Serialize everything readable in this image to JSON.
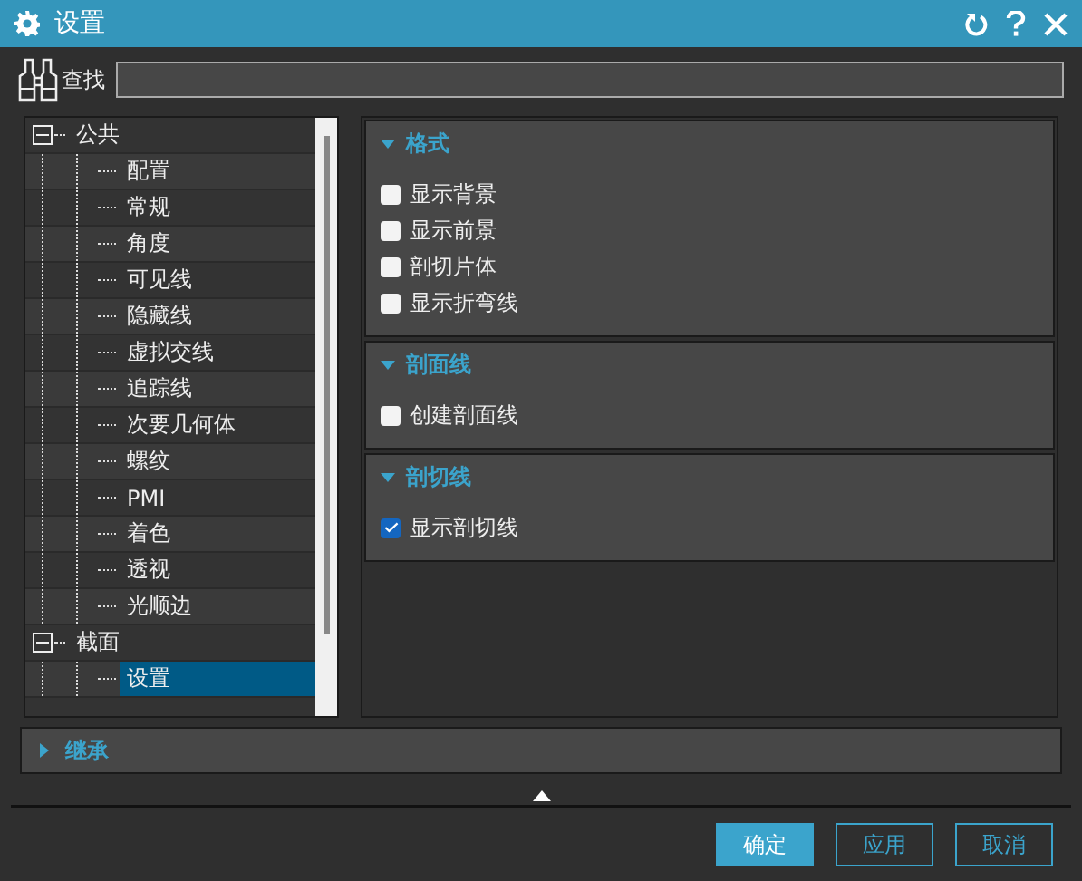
{
  "window": {
    "title": "设置"
  },
  "search": {
    "label": "查找"
  },
  "tree": [
    {
      "label": "公共",
      "expanded": true,
      "selected": false,
      "children": [
        {
          "label": "配置",
          "selected": false
        },
        {
          "label": "常规",
          "selected": false
        },
        {
          "label": "角度",
          "selected": false
        },
        {
          "label": "可见线",
          "selected": false
        },
        {
          "label": "隐藏线",
          "selected": false
        },
        {
          "label": "虚拟交线",
          "selected": false
        },
        {
          "label": "追踪线",
          "selected": false
        },
        {
          "label": "次要几何体",
          "selected": false
        },
        {
          "label": "螺纹",
          "selected": false
        },
        {
          "label": "PMI",
          "selected": false
        },
        {
          "label": "着色",
          "selected": false
        },
        {
          "label": "透视",
          "selected": false
        },
        {
          "label": "光顺边",
          "selected": false
        }
      ]
    },
    {
      "label": "截面",
      "expanded": true,
      "selected": false,
      "children": [
        {
          "label": "设置",
          "selected": true
        }
      ]
    }
  ],
  "groups": [
    {
      "title": "格式",
      "expanded": true,
      "options": [
        {
          "label": "显示背景",
          "checked": false
        },
        {
          "label": "显示前景",
          "checked": false
        },
        {
          "label": "剖切片体",
          "checked": false
        },
        {
          "label": "显示折弯线",
          "checked": false
        }
      ]
    },
    {
      "title": "剖面线",
      "expanded": true,
      "options": [
        {
          "label": "创建剖面线",
          "checked": false
        }
      ]
    },
    {
      "title": "剖切线",
      "expanded": true,
      "options": [
        {
          "label": "显示剖切线",
          "checked": true
        }
      ]
    }
  ],
  "inherit": {
    "title": "继承",
    "expanded": false
  },
  "buttons": [
    {
      "label": "确定",
      "kind": "primary"
    },
    {
      "label": "应用",
      "kind": "secondary"
    },
    {
      "label": "取消",
      "kind": "secondary"
    }
  ]
}
